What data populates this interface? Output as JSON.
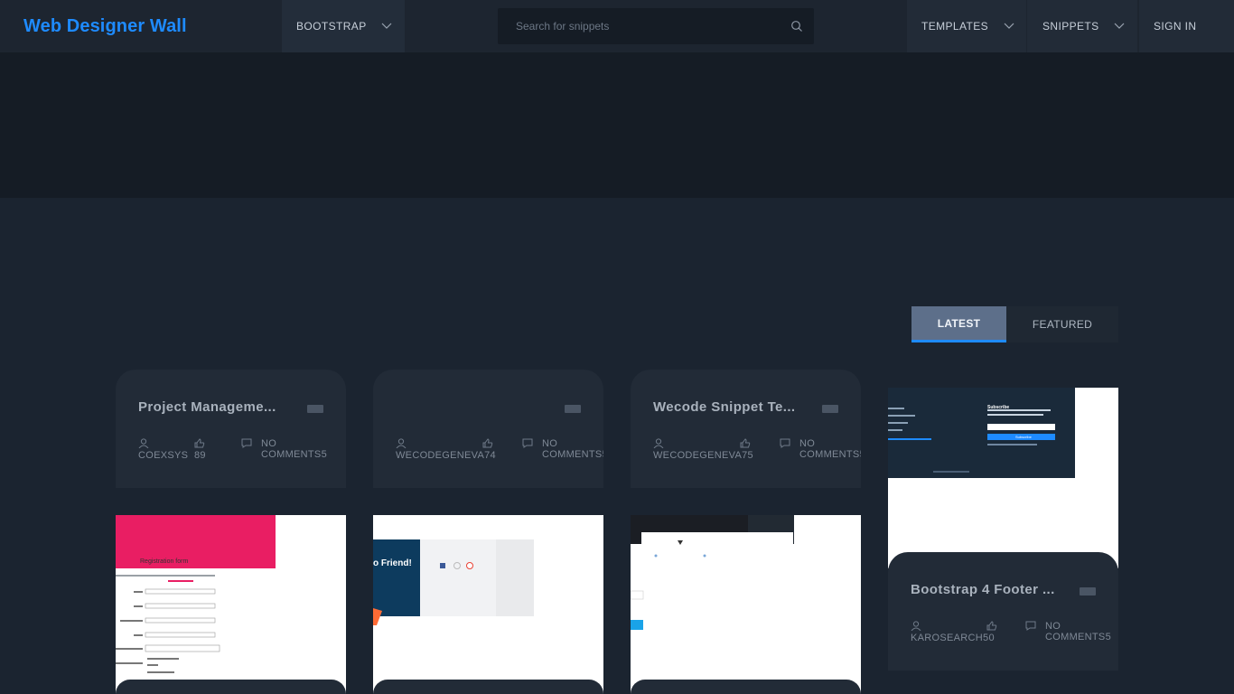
{
  "brand": "Web Designer Wall",
  "nav": {
    "bootstrap": "BOOTSTRAP",
    "templates": "TEMPLATES",
    "snippets": "SNIPPETS",
    "signin": "SIGN IN"
  },
  "search": {
    "placeholder": "Search for snippets"
  },
  "tabs": {
    "latest": "LATEST",
    "featured": "FEATURED"
  },
  "cards": [
    {
      "title": "Project Manageme...",
      "author": "COEXSYS",
      "likes": "89",
      "comments": "NO COMMENTS5"
    },
    {
      "title": "",
      "author": "WECODEGENEVA",
      "likes": "74",
      "comments": "NO COMMENTS5"
    },
    {
      "title": "Wecode Snippet Te...",
      "author": "WECODEGENEVA",
      "likes": "75",
      "comments": "NO COMMENTS5"
    },
    {
      "title": "Bootstrap 4 Footer ...",
      "author": "KAROSEARCH",
      "likes": "50",
      "comments": "NO COMMENTS5"
    }
  ],
  "thumbs": {
    "footer": {
      "heading": "Subscribe",
      "button": "Subscribe"
    },
    "registration": {
      "heading": "Registration form"
    },
    "friend": {
      "text": "o Friend!"
    }
  },
  "colors": {
    "accent": "#1e8bff",
    "background": "#1b2430",
    "card": "#222b37"
  }
}
